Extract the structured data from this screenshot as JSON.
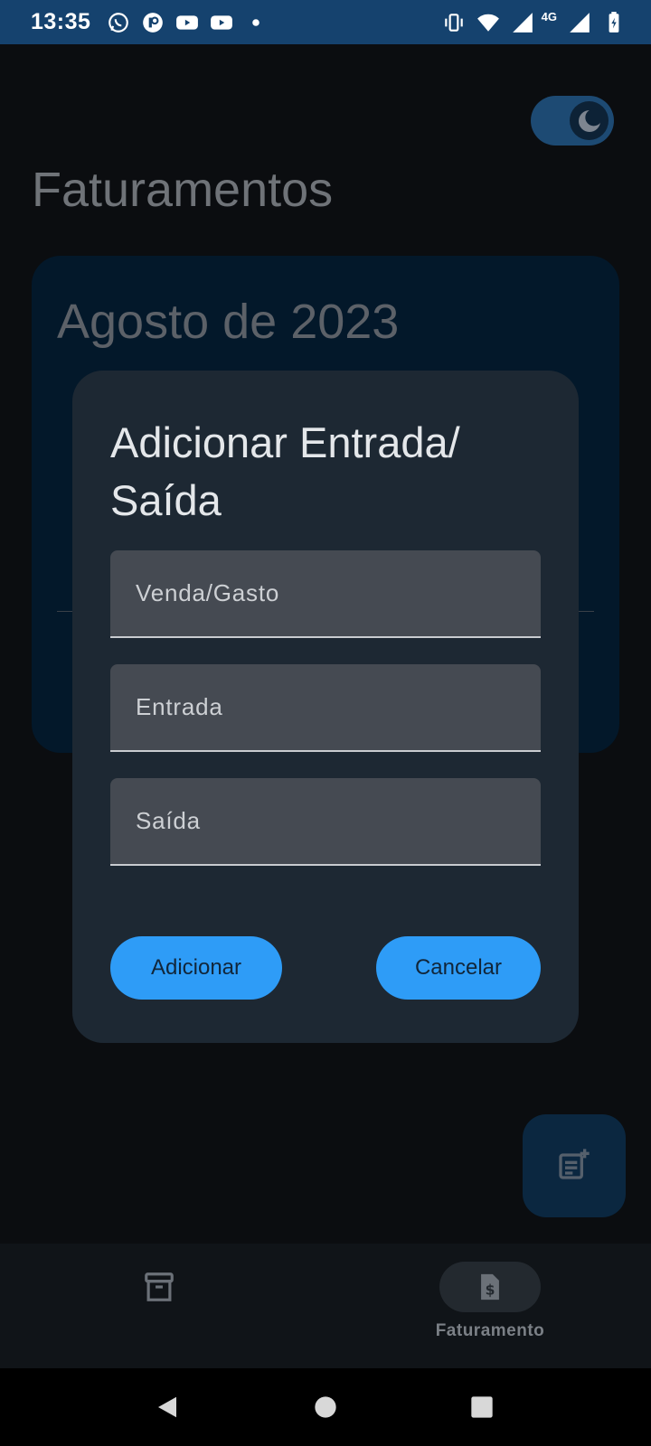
{
  "status_bar": {
    "time": "13:35",
    "left_icons": [
      "whatsapp-icon",
      "app-icon",
      "youtube-icon",
      "youtube-icon",
      "notification-dot-icon"
    ],
    "right_icons": [
      "vibrate-icon",
      "wifi-icon",
      "signal-icon",
      "signal-icon",
      "battery-charging-icon"
    ],
    "network_type": "4G"
  },
  "app": {
    "page_title": "Faturamentos",
    "theme_toggle": {
      "state": "dark",
      "icon": "moon-icon"
    },
    "month_card": {
      "title": "Agosto de 2023"
    }
  },
  "dialog": {
    "title": "Adicionar Entrada/ Saída",
    "fields": [
      {
        "placeholder": "Venda/Gasto",
        "value": ""
      },
      {
        "placeholder": "Entrada",
        "value": ""
      },
      {
        "placeholder": "Saída",
        "value": ""
      }
    ],
    "add_label": "Adicionar",
    "cancel_label": "Cancelar"
  },
  "fab": {
    "icon": "add-note-icon"
  },
  "bottom_nav": {
    "items": [
      {
        "icon": "archive-icon",
        "label": ""
      },
      {
        "icon": "invoice-dollar-icon",
        "label": "Faturamento",
        "selected": true
      }
    ]
  },
  "colors": {
    "status_bar": "#15426e",
    "dialog_bg": "#1d2833",
    "accent": "#2e9cf7",
    "card_bg": "#03182a"
  }
}
